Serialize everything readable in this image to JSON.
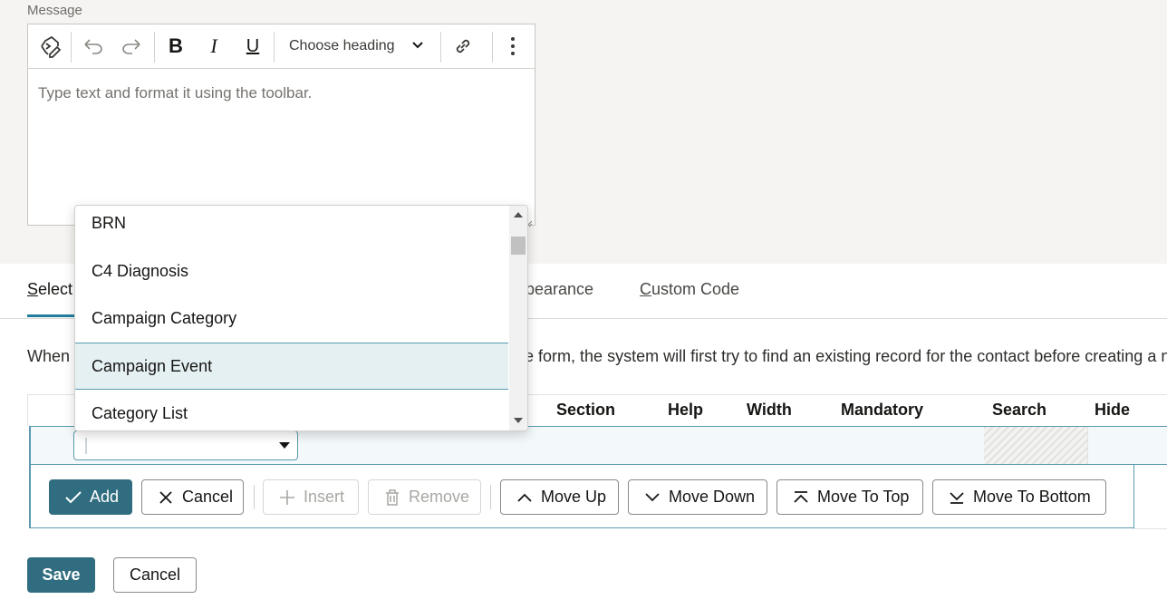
{
  "message": {
    "label": "Message",
    "placeholder": "Type text and format it using the toolbar.",
    "toolbar": {
      "heading_select": "Choose heading",
      "icons": [
        "source-edit-icon",
        "undo-icon",
        "redo-icon",
        "bold-icon",
        "italic-icon",
        "underline-icon",
        "link-icon",
        "more-icon"
      ]
    }
  },
  "tabs": [
    {
      "label": "Select"
    },
    {
      "label": "Appearance",
      "visible_fragment": "ppearance"
    },
    {
      "label": "Custom Code"
    }
  ],
  "info_text": "When",
  "info_text_tail": "e form, the system will first try to find an existing record for the contact before creating a ne",
  "grid": {
    "columns": [
      "Section",
      "Help",
      "Width",
      "Mandatory",
      "Search",
      "Hide"
    ]
  },
  "buttons": {
    "add": "Add",
    "cancel": "Cancel",
    "insert": "Insert",
    "remove": "Remove",
    "move_up": "Move Up",
    "move_down": "Move Down",
    "move_to_top": "Move To Top",
    "move_to_bottom": "Move To Bottom"
  },
  "footer": {
    "save": "Save",
    "cancel": "Cancel"
  },
  "dropdown": {
    "items": [
      "BRN",
      "C4 Diagnosis",
      "Campaign Category",
      "Campaign Event",
      "Category List"
    ],
    "highlighted": "Campaign Event"
  },
  "colors": {
    "primary": "#316d80",
    "accent": "#227e9e",
    "highlight": "#e5f0f3"
  }
}
